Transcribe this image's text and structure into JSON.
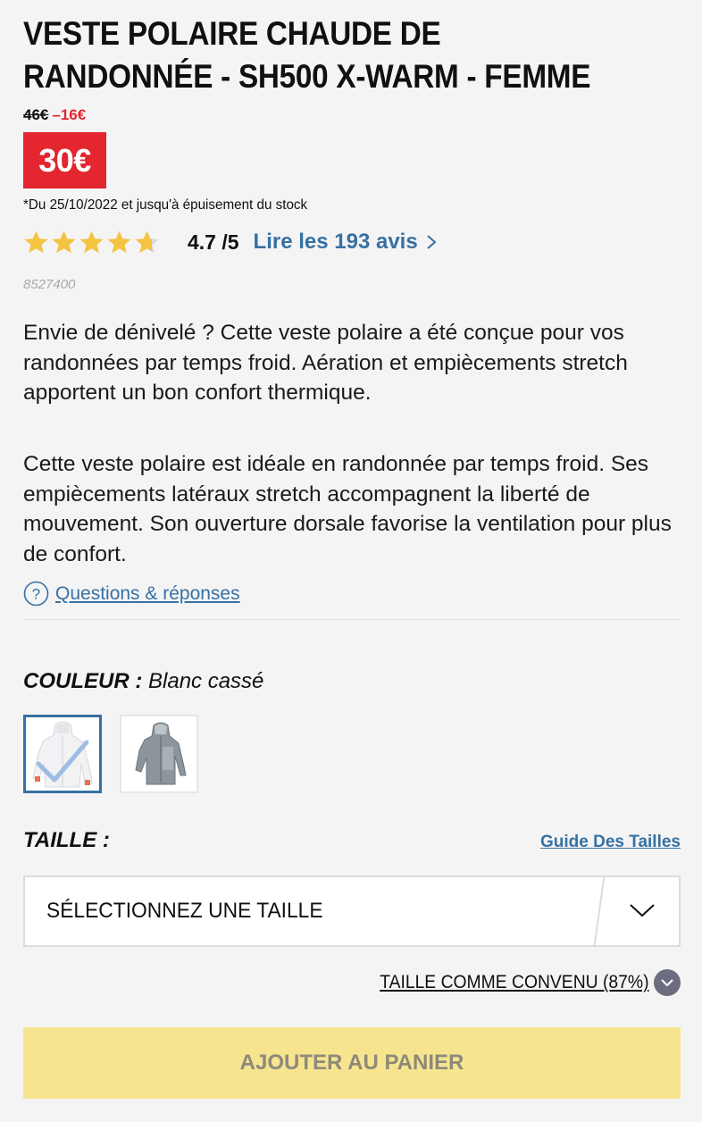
{
  "product": {
    "title_line1": "VESTE POLAIRE CHAUDE DE",
    "title_line2": "RANDONNÉE - SH500 X-WARM - FEMME",
    "old_price": "46€",
    "discount": "–16€",
    "price": "30€",
    "promo_note": "*Du 25/10/2022 et jusqu'à épuisement du stock",
    "rating": {
      "value_text": "4.7 /5",
      "stars": 4.7,
      "reviews_link": "Lire les 193 avis",
      "star_color": "#f4c341"
    },
    "sku": "8527400",
    "description_1": "Envie de dénivelé ? Cette veste polaire a été conçue pour vos randonnées par temps froid. Aération et empiècements stretch apportent un bon confort thermique.",
    "description_2": "Cette veste polaire est idéale en randonnée par temps froid. Ses empiècements latéraux stretch accompagnent la liberté de mouvement. Son ouverture dorsale favorise la ventilation pour plus de confort.",
    "qa_link": "Questions & réponses"
  },
  "color": {
    "label": "COULEUR :",
    "value": "Blanc cassé",
    "swatches": [
      {
        "name": "Blanc cassé",
        "selected": true
      },
      {
        "name": "Gris",
        "selected": false
      }
    ]
  },
  "size": {
    "label": "TAILLE :",
    "guide_link": "Guide Des Tailles",
    "placeholder": "SÉLECTIONNEZ UNE TAILLE",
    "fit_text": "TAILLE COMME CONVENU (87%)"
  },
  "cart": {
    "button_label": "AJOUTER AU PANIER",
    "button_color": "#f7e48f"
  },
  "colors": {
    "accent_blue": "#3671a3",
    "price_red": "#e3262f",
    "background": "#f5f4f5"
  }
}
